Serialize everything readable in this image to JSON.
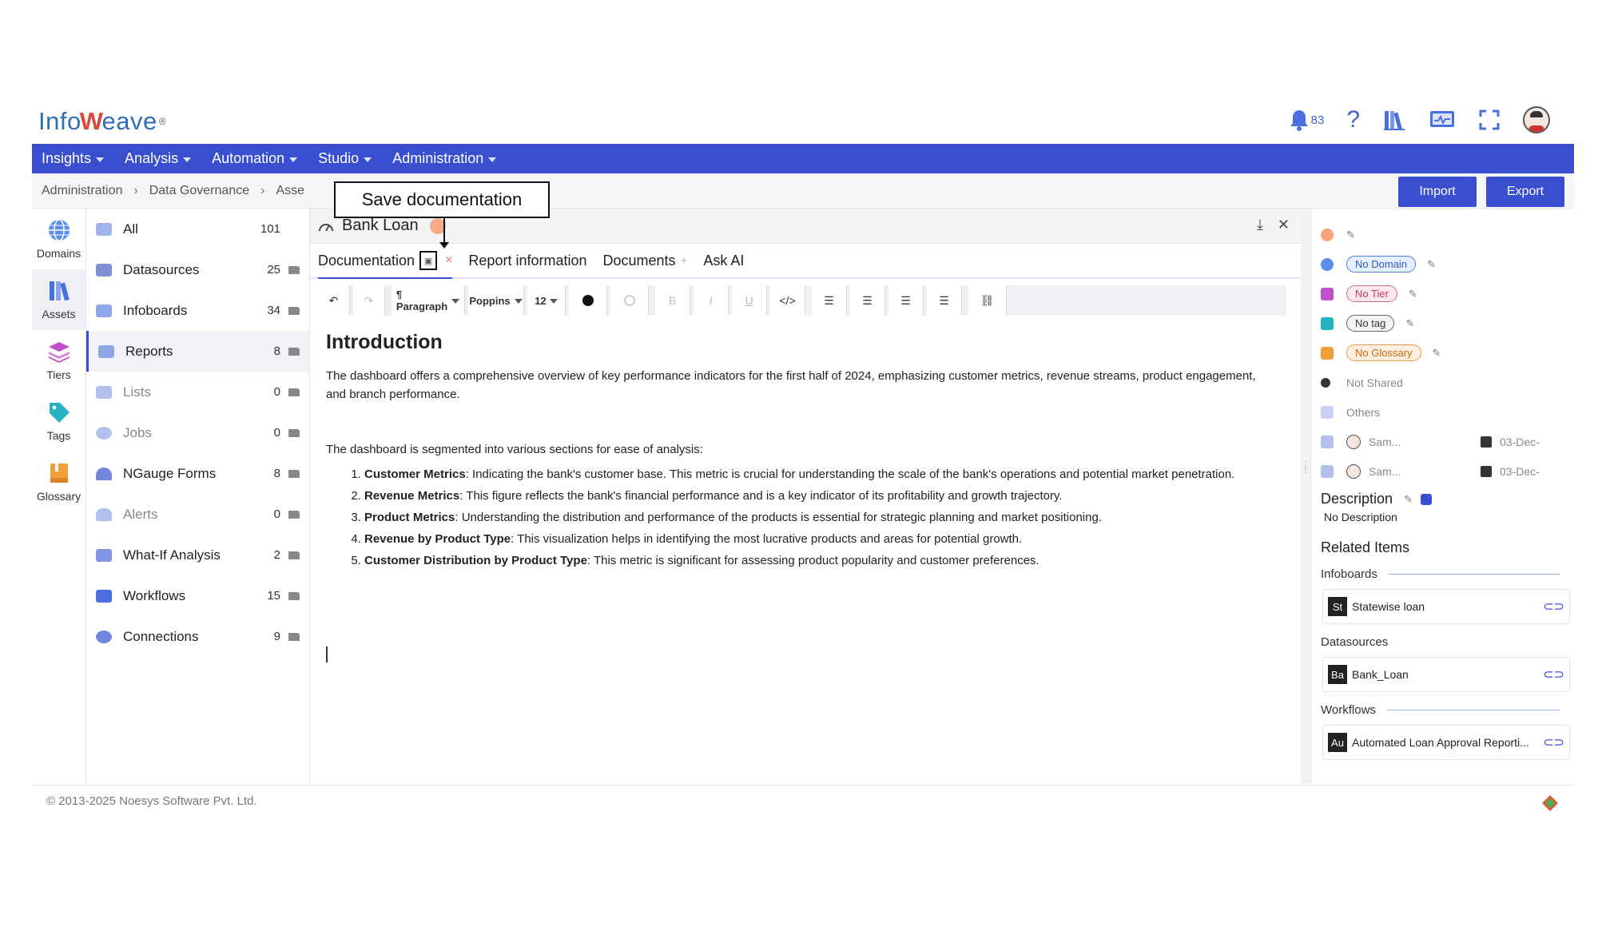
{
  "brand": {
    "logo_text_1": "Info",
    "logo_text_2": "eave",
    "logo_mark": "W",
    "reg": "®"
  },
  "header": {
    "notification_count": "83",
    "help": "?",
    "icons": [
      "bell-icon",
      "help-icon",
      "library-icon",
      "monitor-icon",
      "fullscreen-icon",
      "user-avatar"
    ]
  },
  "topnav": {
    "items": [
      "Insights",
      "Analysis",
      "Automation",
      "Studio",
      "Administration"
    ]
  },
  "breadcrumb": {
    "items": [
      "Administration",
      "Data Governance",
      "Asse"
    ]
  },
  "actions": {
    "import": "Import",
    "export": "Export"
  },
  "rail": {
    "items": [
      "Domains",
      "Assets",
      "Tiers",
      "Tags",
      "Glossary"
    ]
  },
  "assets": {
    "items": [
      {
        "label": "All",
        "count": "101"
      },
      {
        "label": "Datasources",
        "count": "25"
      },
      {
        "label": "Infoboards",
        "count": "34"
      },
      {
        "label": "Reports",
        "count": "8"
      },
      {
        "label": "Lists",
        "count": "0"
      },
      {
        "label": "Jobs",
        "count": "0"
      },
      {
        "label": "NGauge Forms",
        "count": "8"
      },
      {
        "label": "Alerts",
        "count": "0"
      },
      {
        "label": "What-If Analysis",
        "count": "2"
      },
      {
        "label": "Workflows",
        "count": "15"
      },
      {
        "label": "Connections",
        "count": "9"
      }
    ]
  },
  "document": {
    "title": "Bank Loan",
    "tabs": [
      "Documentation",
      "Report information",
      "Documents",
      "Ask AI"
    ],
    "tab_close": "×",
    "tab_add": "+",
    "toolbar": {
      "paragraph": "¶ Paragraph",
      "font": "Poppins",
      "size": "12",
      "bold": "B",
      "italic": "I",
      "underline": "U",
      "code": "</>"
    },
    "heading": "Introduction",
    "intro": "The dashboard offers a comprehensive overview of key performance indicators for the first half of 2024, emphasizing customer metrics, revenue streams, product engagement, and branch performance.",
    "segment_intro": "The dashboard is segmented into various sections for ease of analysis:",
    "list": [
      {
        "term": "Customer Metrics",
        "text": ": Indicating the bank's customer base. This metric is crucial for understanding the scale of the bank's operations and potential market penetration."
      },
      {
        "term": "Revenue Metrics",
        "text": ": This figure reflects the bank's financial performance and is a key indicator of its profitability and growth trajectory."
      },
      {
        "term": "Product Metrics",
        "text": ": Understanding the distribution and performance of the products is essential for strategic planning and market positioning."
      },
      {
        "term": "Revenue by Product Type",
        "text": ": This visualization helps in identifying the most lucrative products and areas for potential growth."
      },
      {
        "term": "Customer Distribution by Product Type",
        "text": ": This metric is significant for assessing product popularity and customer preferences."
      }
    ]
  },
  "callout": {
    "text": "Save documentation"
  },
  "details": {
    "domain": "No Domain",
    "tier": "No Tier",
    "tag": "No tag",
    "glossary": "No Glossary",
    "shared": "Not Shared",
    "others": "Others",
    "created_by": "Sam...",
    "created_on": "03-Dec-",
    "modified_by": "Sam...",
    "modified_on": "03-Dec-",
    "description_title": "Description",
    "description": "No Description",
    "related_title": "Related Items",
    "groups": [
      {
        "name": "Infoboards",
        "items": [
          {
            "badge": "St",
            "name": "Statewise loan"
          }
        ]
      },
      {
        "name": "Datasources",
        "items": [
          {
            "badge": "Ba",
            "name": "Bank_Loan"
          }
        ]
      },
      {
        "name": "Workflows",
        "items": [
          {
            "badge": "Au",
            "name": "Automated Loan Approval Reporti..."
          }
        ]
      }
    ]
  },
  "footer": {
    "copyright": "© 2013-2025 Noesys Software Pvt. Ltd."
  },
  "colors": {
    "primary": "#3a4fcf",
    "accent_orange": "#f5a37a"
  }
}
